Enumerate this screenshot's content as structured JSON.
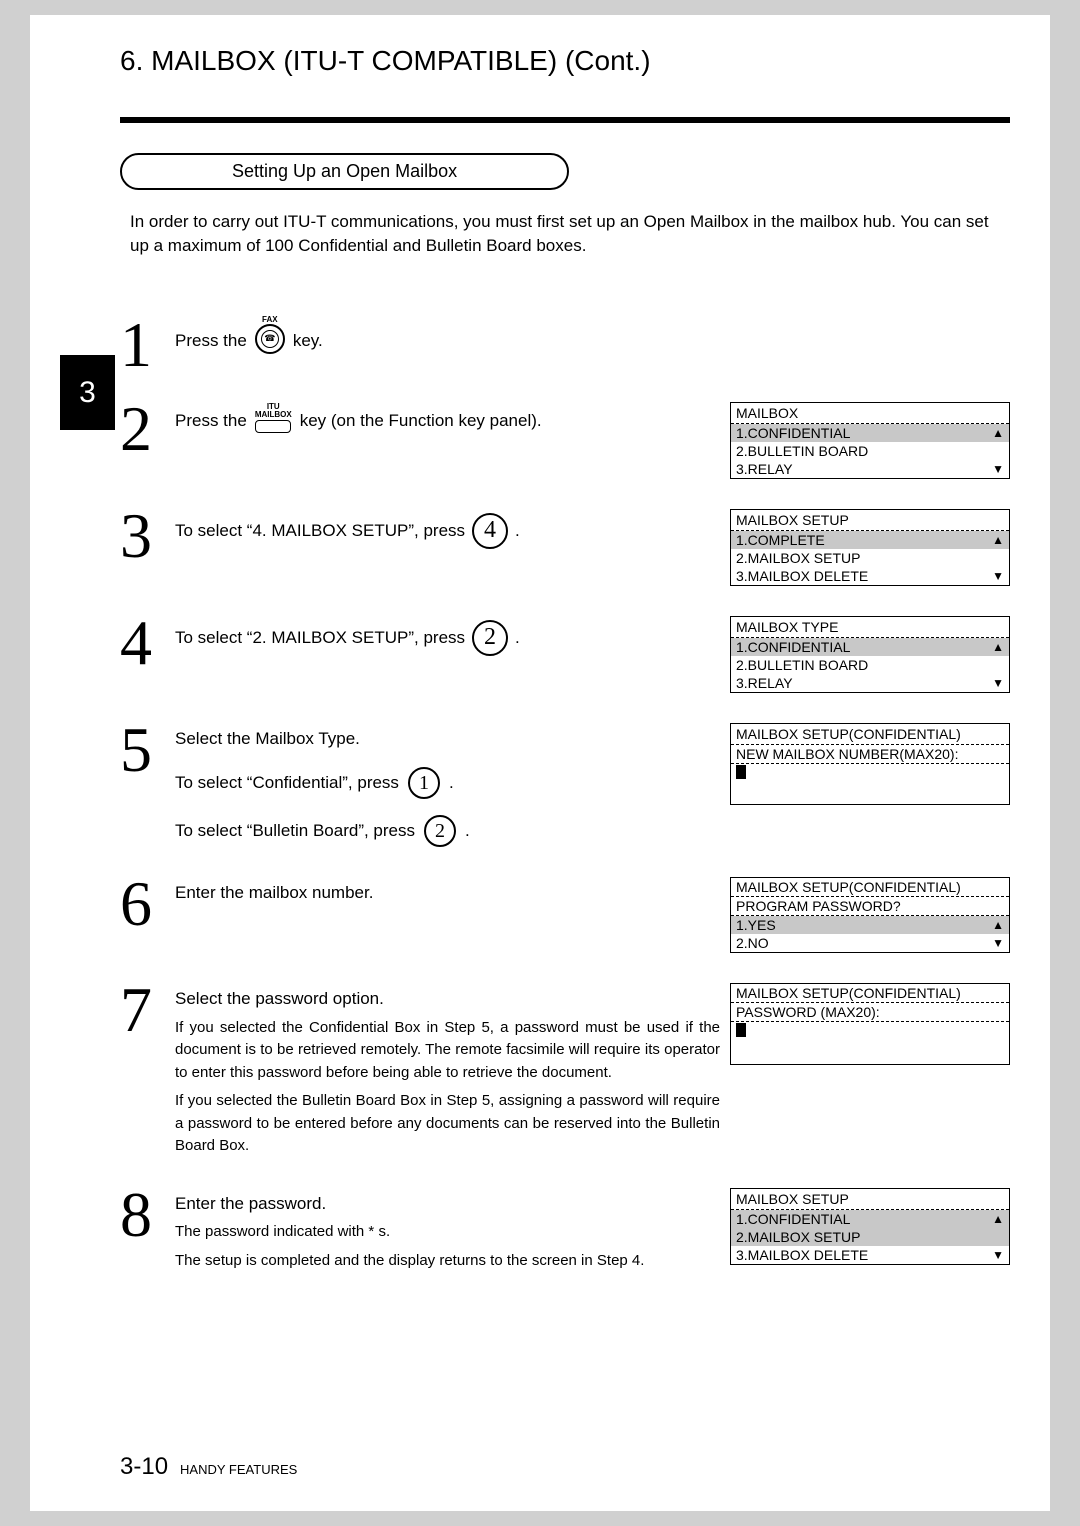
{
  "header": "6. MAILBOX (ITU-T COMPATIBLE) (Cont.)",
  "subhead": "Setting Up an Open Mailbox",
  "intro": "In order to carry out ITU-T communications, you must first set up an Open Mailbox in the mailbox hub. You can set up a maximum of 100 Confidential and Bulletin Board boxes.",
  "chapterTab": "3",
  "keys": {
    "faxTop": "FAX",
    "ituTop": "ITU",
    "ituBottom": "MAILBOX"
  },
  "steps": {
    "s1": {
      "num": "1",
      "a": "Press the",
      "b": "key."
    },
    "s2": {
      "num": "2",
      "a": "Press the",
      "b": "key (on the Function key panel)."
    },
    "s3": {
      "num": "3",
      "a": "To select “4. MAILBOX SETUP”, press",
      "keyDigit": "4",
      "b": "."
    },
    "s4": {
      "num": "4",
      "a": "To select “2. MAILBOX SETUP”, press",
      "keyDigit": "2",
      "b": "."
    },
    "s5": {
      "num": "5",
      "title": "Select the Mailbox Type.",
      "line1a": "To select “Confidential”, press",
      "line1key": "1",
      "line1b": ".",
      "line2a": "To select “Bulletin Board”, press",
      "line2key": "2",
      "line2b": "."
    },
    "s6": {
      "num": "6",
      "title": "Enter the mailbox number."
    },
    "s7": {
      "num": "7",
      "title": "Select the password option.",
      "p1": "If you selected the Confidential Box in Step 5, a password must be used if the document is to be retrieved remotely. The remote facsimile will require its operator to enter this password before being able to retrieve the document.",
      "p2": "If you selected the Bulletin Board Box in Step 5, assigning a password will require a password to be entered before any documents can be reserved into the Bulletin Board Box."
    },
    "s8": {
      "num": "8",
      "title": "Enter the password.",
      "sub1": "The password indicated with * s.",
      "sub2": "The setup is completed and the display returns to the screen in Step 4."
    }
  },
  "lcd": {
    "box1": {
      "title": "MAILBOX",
      "r1": "1.CONFIDENTIAL",
      "r2": "2.BULLETIN BOARD",
      "r3": "3.RELAY"
    },
    "box2": {
      "title": "MAILBOX SETUP",
      "r1": "1.COMPLETE",
      "r2": "2.MAILBOX SETUP",
      "r3": "3.MAILBOX DELETE"
    },
    "box3": {
      "title": "MAILBOX TYPE",
      "r1": "1.CONFIDENTIAL",
      "r2": "2.BULLETIN BOARD",
      "r3": "3.RELAY"
    },
    "box4": {
      "title": "MAILBOX  SETUP(CONFIDENTIAL)",
      "r1": "NEW MAILBOX NUMBER(MAX20):"
    },
    "box5": {
      "title": "MAILBOX  SETUP(CONFIDENTIAL)",
      "sub": "PROGRAM PASSWORD?",
      "r1": "1.YES",
      "r2": "2.NO"
    },
    "box6": {
      "title": "MAILBOX  SETUP(CONFIDENTIAL)",
      "r1": "PASSWORD (MAX20):"
    },
    "box7": {
      "title": "MAILBOX SETUP",
      "r1": "1.CONFIDENTIAL",
      "r2": "2.MAILBOX SETUP",
      "r3": "3.MAILBOX DELETE"
    }
  },
  "footer": {
    "page": "3-10",
    "section": "HANDY FEATURES"
  }
}
